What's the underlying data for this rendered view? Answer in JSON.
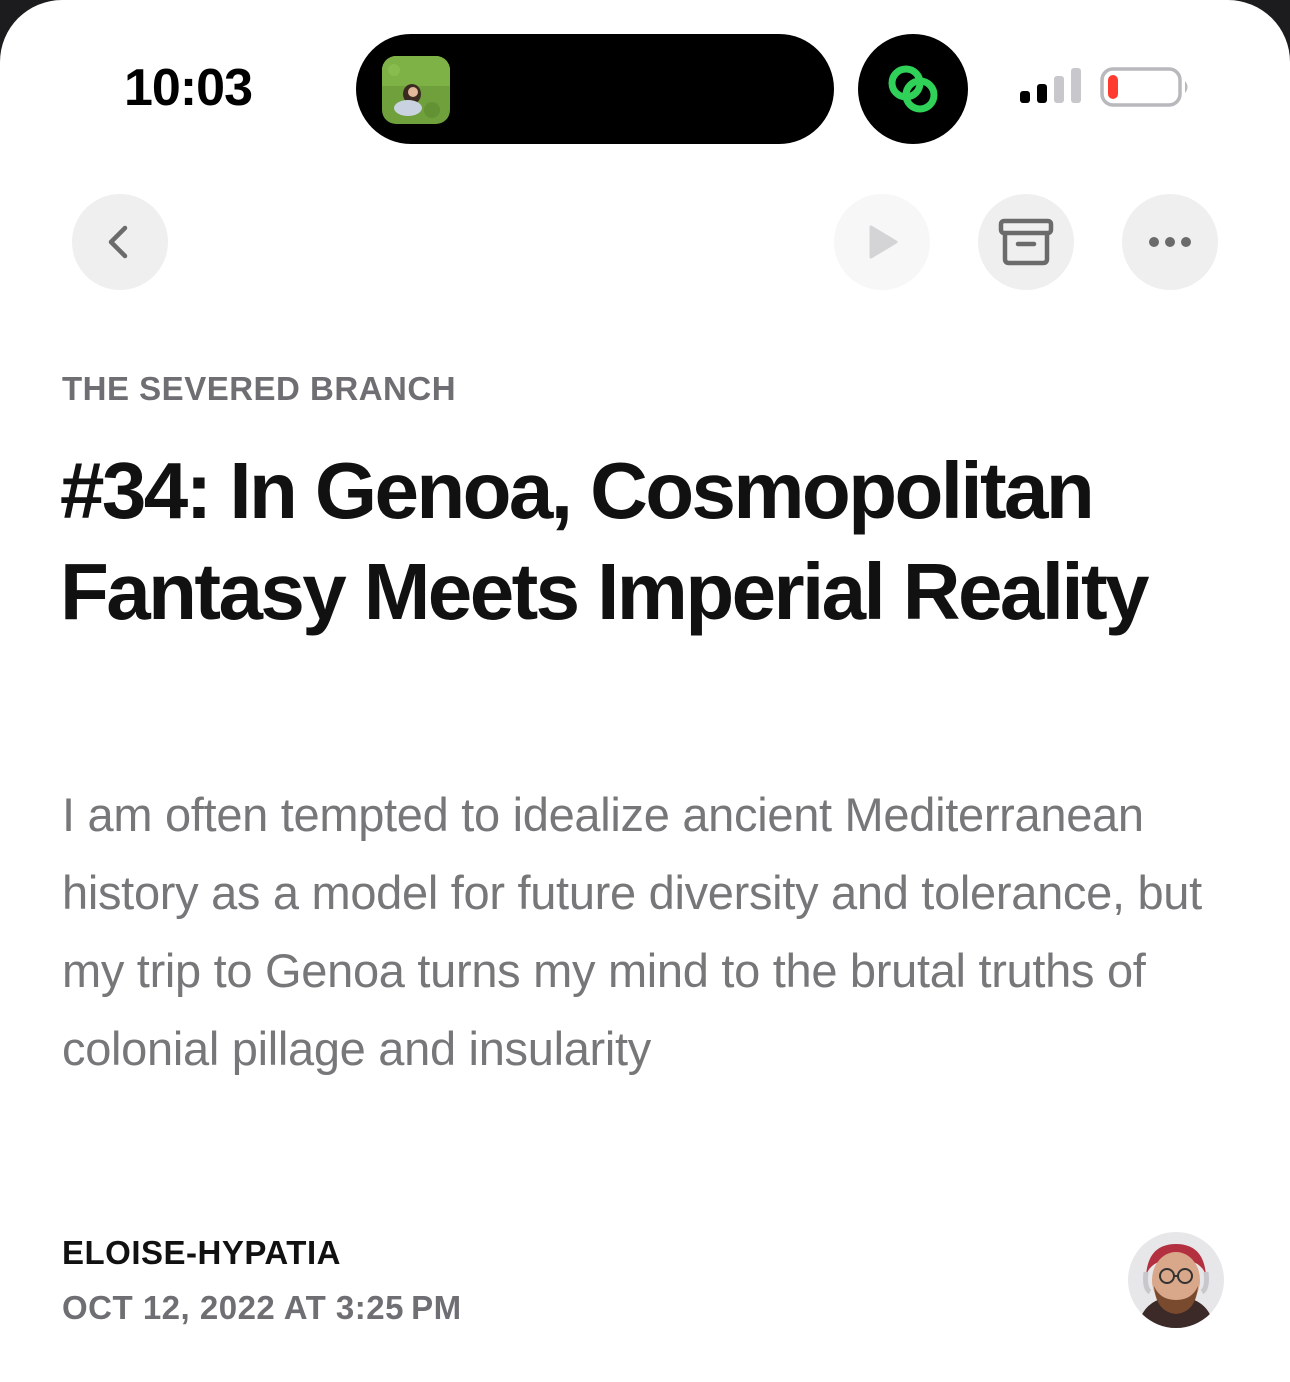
{
  "status_bar": {
    "time": "10:03",
    "battery_color": "#ff3b30",
    "activity_icon": "link-icon",
    "activity_color": "#30d158"
  },
  "toolbar": {
    "back_icon": "chevron-left-icon",
    "play_icon": "play-icon",
    "archive_icon": "archive-box-icon",
    "more_icon": "ellipsis-icon"
  },
  "article": {
    "publication": "THE SEVERED BRANCH",
    "title": "#34: In Genoa, Cosmopolitan Fantasy Meets Imperial Reality",
    "subtitle": "I am often tempted to idealize ancient Mediterranean history as a model for future diversity and tolerance, but my trip to Genoa turns my mind to the brutal truths of colonial pillage and insularity",
    "author": "ELOISE-HYPATIA",
    "date": "OCT 12, 2022 AT 3:25 PM"
  }
}
